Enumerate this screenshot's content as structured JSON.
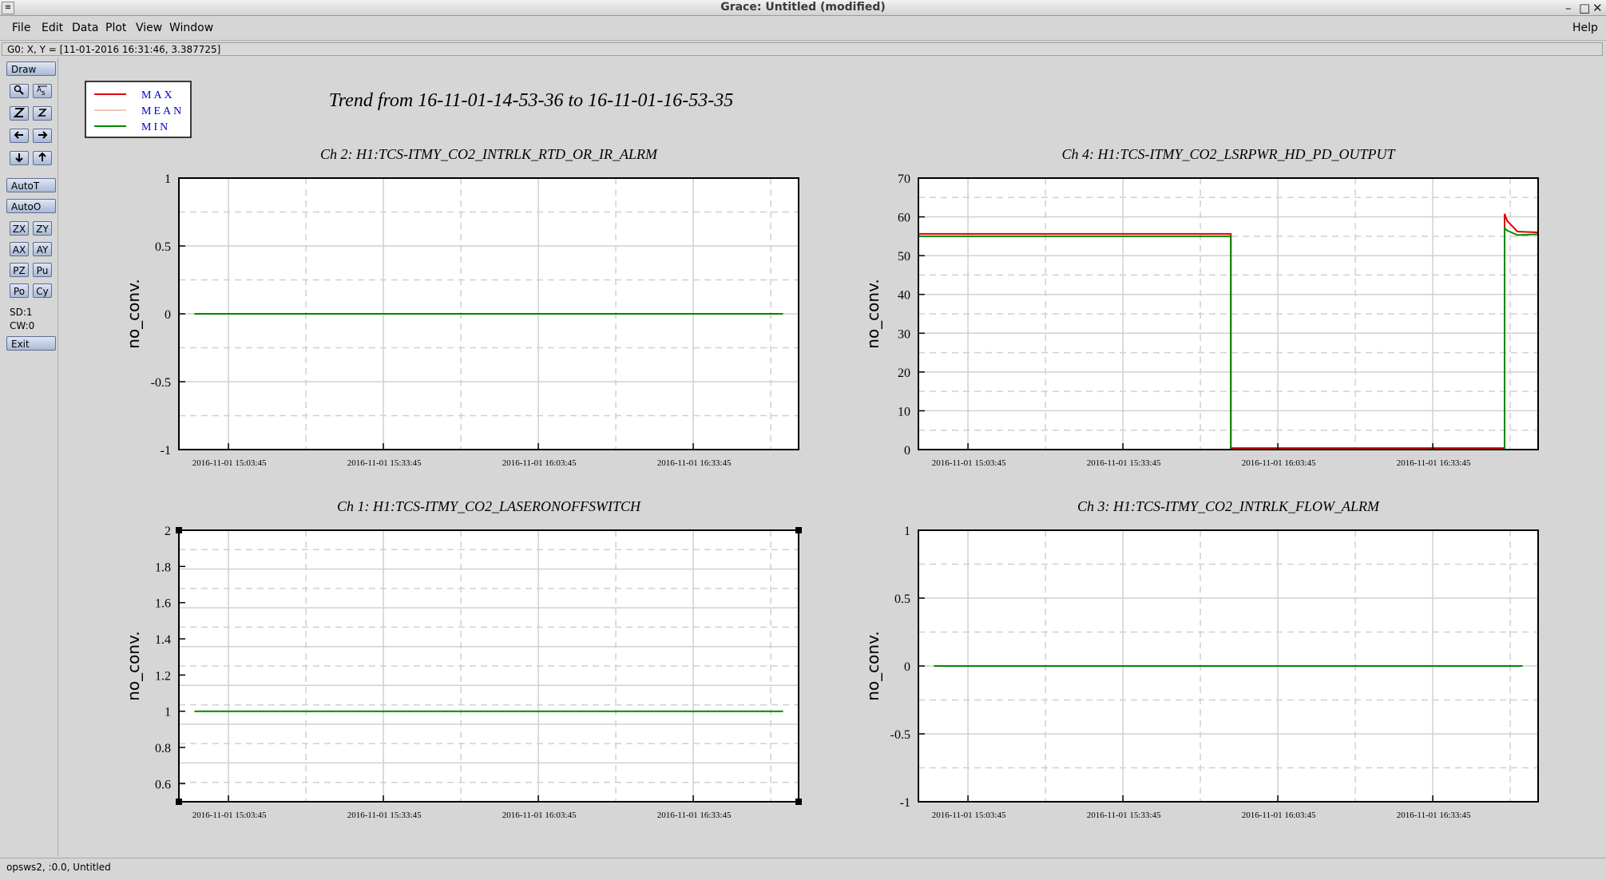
{
  "window": {
    "title": "Grace: Untitled (modified)",
    "controls": [
      "minimize-icon",
      "maximize-icon",
      "close-icon"
    ]
  },
  "menubar": {
    "file": "File",
    "edit": "Edit",
    "data": "Data",
    "plot": "Plot",
    "view": "View",
    "window": "Window",
    "help": "Help"
  },
  "locator": "G0: X, Y = [11-01-2016 16:31:46, 3.387725]",
  "toolbar": {
    "draw": "Draw",
    "icons": [
      "zoom-icon",
      "autoscale-text-icon",
      "zoom-x-icon",
      "zoom-y-icon",
      "arrow-left-icon",
      "arrow-right-icon",
      "arrow-down-icon",
      "arrow-up-icon"
    ],
    "autot": "AutoT",
    "autoo": "AutoO",
    "zx": "ZX",
    "zy": "ZY",
    "ax": "AX",
    "ay": "AY",
    "pz": "PZ",
    "pu": "Pu",
    "po": "Po",
    "cy": "Cy",
    "sd": "SD:1",
    "cw": "CW:0",
    "exit": "Exit"
  },
  "footer": "opsws2, :0.0, Untitled",
  "colors": {
    "max": "#dd0000",
    "mean": "#ee8888",
    "min": "#008800",
    "legend_text": "#0000cc"
  },
  "chart_data": {
    "title": "Trend from 16-11-01-14-53-36 to 16-11-01-16-53-35",
    "legend": {
      "placement": "top-left",
      "entries": [
        {
          "name": "MAX",
          "color": "#dd0000"
        },
        {
          "name": "MEAN",
          "color": "#ee8888"
        },
        {
          "name": "MIN",
          "color": "#008800"
        }
      ]
    },
    "panels": [
      {
        "type": "line",
        "title": "Ch 2: H1:TCS-ITMY_CO2_INTRLK_RTD_OR_IR_ALRM",
        "ylabel": "no_conv.",
        "ylim": [
          -1,
          1
        ],
        "yticks": [
          1,
          0.5,
          0,
          -0.5,
          -1
        ],
        "xticks": [
          "2016-11-01 15:03:45",
          "2016-11-01 15:33:45",
          "2016-11-01 16:03:45",
          "2016-11-01 16:33:45"
        ],
        "xlim_min": [
          0,
          120
        ],
        "series": [
          {
            "name": "MIN",
            "x_min": [
              3,
              117
            ],
            "y": [
              0,
              0
            ]
          }
        ],
        "grid": true
      },
      {
        "type": "line",
        "title": "Ch 4: H1:TCS-ITMY_CO2_LSRPWR_HD_PD_OUTPUT",
        "ylabel": "no_conv.",
        "ylim": [
          0,
          70
        ],
        "yticks": [
          70,
          60,
          50,
          40,
          30,
          20,
          10,
          0
        ],
        "xticks": [
          "2016-11-01 15:03:45",
          "2016-11-01 15:33:45",
          "2016-11-01 16:03:45",
          "2016-11-01 16:33:45"
        ],
        "xlim_min": [
          0,
          120
        ],
        "series": [
          {
            "name": "MAX",
            "x_min": [
              0,
              60.5,
              60.5,
              113.5,
              113.5,
              114,
              116,
              120
            ],
            "y": [
              55.6,
              55.6,
              0.4,
              0.4,
              60.8,
              59,
              56.2,
              56
            ]
          },
          {
            "name": "MIN",
            "x_min": [
              0,
              60.5,
              60.5,
              113.5,
              113.5,
              114,
              116,
              120
            ],
            "y": [
              55.0,
              55.0,
              0,
              0,
              57,
              56.5,
              55.3,
              55.5
            ]
          }
        ],
        "grid": true
      },
      {
        "type": "line",
        "title": "Ch 1: H1:TCS-ITMY_CO2_LASERONOFFSWITCH",
        "ylabel": "no_conv.",
        "ylim": [
          0.5,
          2
        ],
        "yticks": [
          2,
          1.8,
          1.6,
          1.4,
          1.2,
          1,
          0.8,
          0.6
        ],
        "xticks": [
          "2016-11-01 15:03:45",
          "2016-11-01 15:33:45",
          "2016-11-01 16:03:45",
          "2016-11-01 16:33:45"
        ],
        "xlim_min": [
          0,
          120
        ],
        "series": [
          {
            "name": "MIN",
            "x_min": [
              3,
              117
            ],
            "y": [
              1,
              1
            ]
          }
        ],
        "grid": true,
        "selected": true
      },
      {
        "type": "line",
        "title": "Ch 3: H1:TCS-ITMY_CO2_INTRLK_FLOW_ALRM",
        "ylabel": "no_conv.",
        "ylim": [
          -1,
          1
        ],
        "yticks": [
          1,
          0.5,
          0,
          -0.5,
          -1
        ],
        "xticks": [
          "2016-11-01 15:03:45",
          "2016-11-01 15:33:45",
          "2016-11-01 16:03:45",
          "2016-11-01 16:33:45"
        ],
        "xlim_min": [
          0,
          120
        ],
        "series": [
          {
            "name": "MIN",
            "x_min": [
              3,
              117
            ],
            "y": [
              0,
              0
            ]
          }
        ],
        "grid": true
      }
    ]
  }
}
